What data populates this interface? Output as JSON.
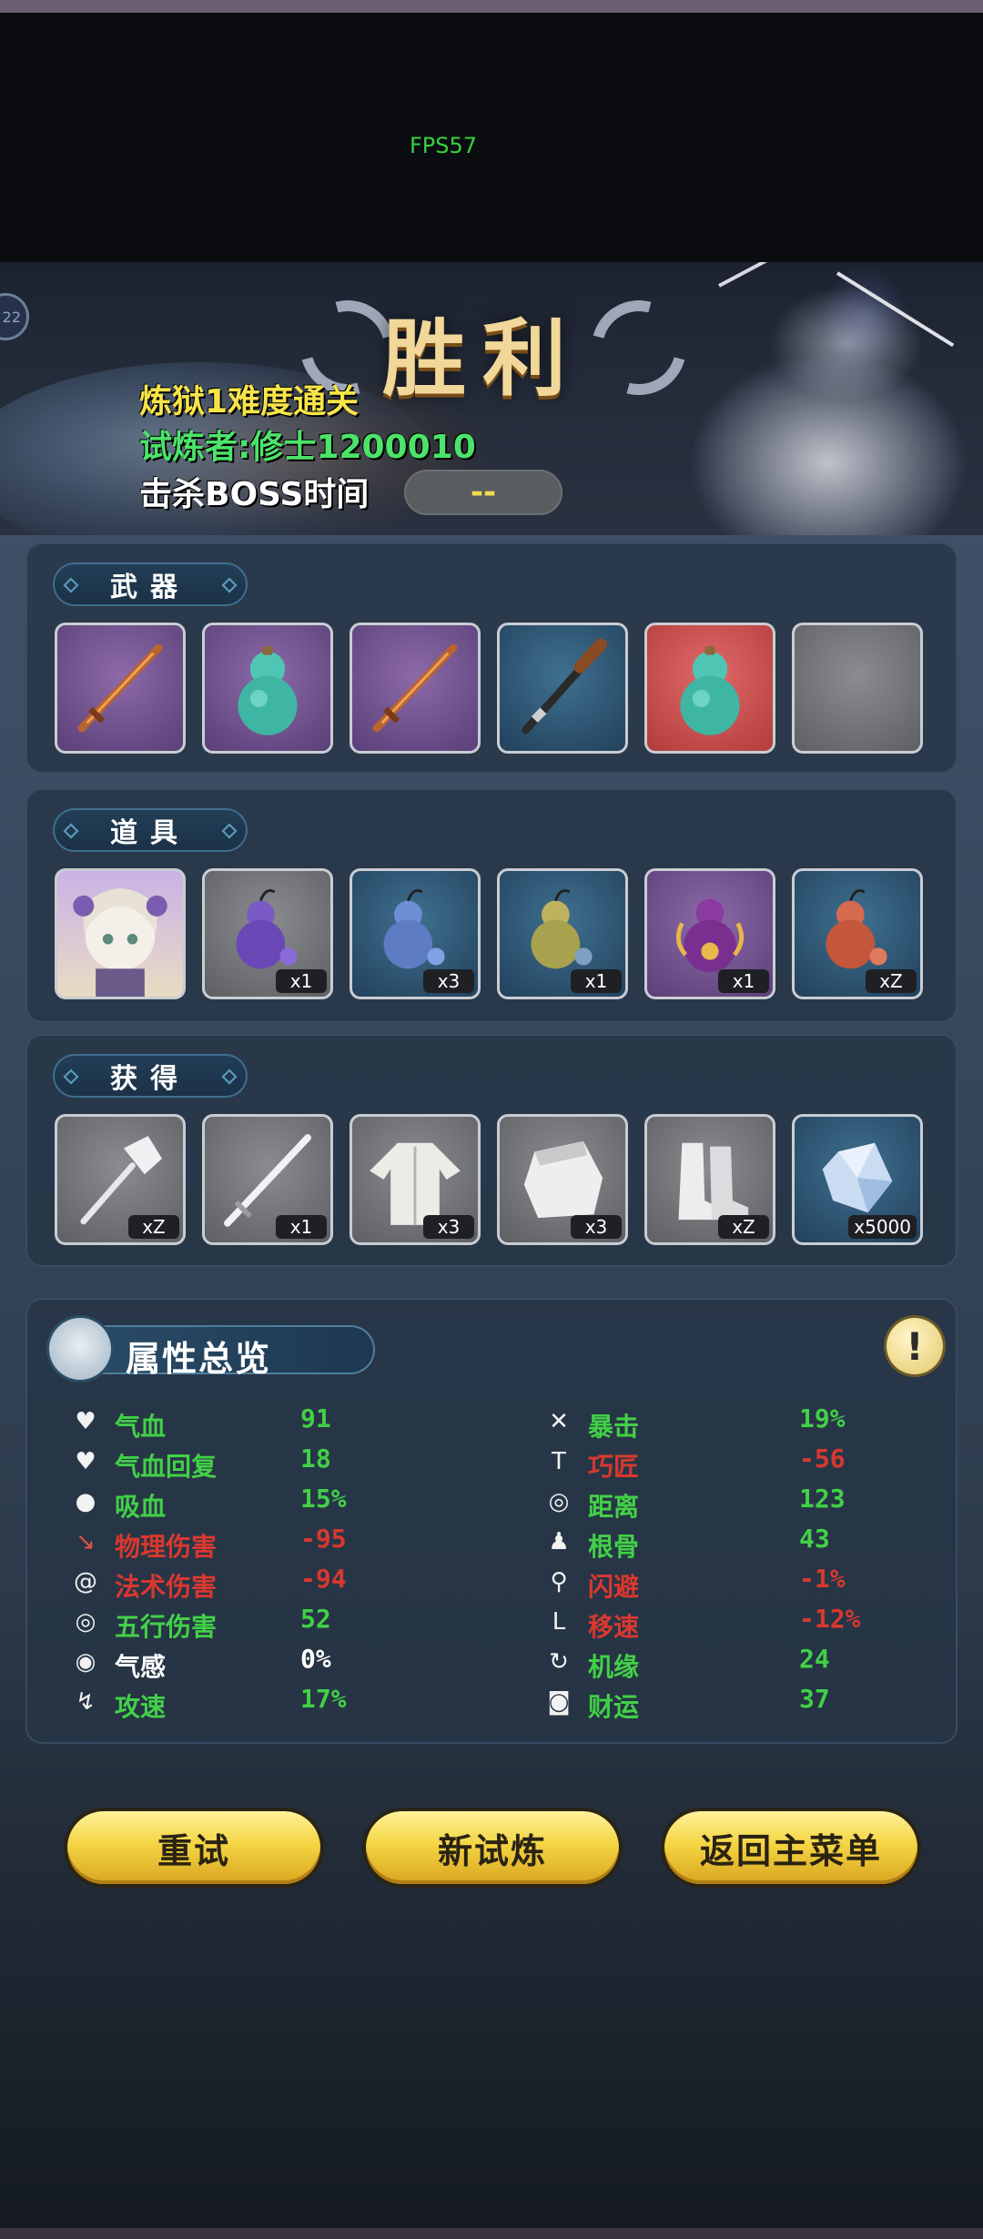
{
  "fps": "FPS57",
  "banner": {
    "title": "胜利",
    "level": "22",
    "difficulty": "炼狱1难度通关",
    "trainee": "试炼者:修士1200010",
    "boss_time_label": "击杀BOSS时间",
    "boss_time_value": "--"
  },
  "weapons": {
    "label": "武器",
    "slots": [
      {
        "icon": "bronze-sword-icon",
        "rarity": "purple"
      },
      {
        "icon": "jade-gourd-icon",
        "rarity": "purple"
      },
      {
        "icon": "bronze-sword-icon",
        "rarity": "purple"
      },
      {
        "icon": "staff-icon",
        "rarity": "blue"
      },
      {
        "icon": "jade-gourd-icon",
        "rarity": "red"
      },
      {
        "icon": "empty-slot",
        "rarity": "gray"
      }
    ]
  },
  "items": {
    "label": "道具",
    "slots": [
      {
        "icon": "character-portrait",
        "qty": ""
      },
      {
        "icon": "purple-gourd-potion-icon",
        "qty": "x1"
      },
      {
        "icon": "blue-gourd-potion-icon",
        "qty": "x3"
      },
      {
        "icon": "yellow-gourd-potion-icon",
        "qty": "x1"
      },
      {
        "icon": "ornate-gourd-potion-icon",
        "qty": "x1"
      },
      {
        "icon": "red-gourd-potion-icon",
        "qty": "xZ"
      }
    ]
  },
  "rewards": {
    "label": "获得",
    "slots": [
      {
        "icon": "hammer-icon",
        "qty": "xZ"
      },
      {
        "icon": "sword-icon",
        "qty": "x1"
      },
      {
        "icon": "robe-icon",
        "qty": "x3"
      },
      {
        "icon": "bracer-icon",
        "qty": "x3"
      },
      {
        "icon": "boots-icon",
        "qty": "xZ"
      },
      {
        "icon": "crystal-icon",
        "qty": "x5000"
      }
    ]
  },
  "stats": {
    "title": "属性总览",
    "left": [
      {
        "label": "气血",
        "value": "91",
        "value_color": "green",
        "label_color": "green",
        "icon": "heart-icon"
      },
      {
        "label": "气血回复",
        "value": "18",
        "value_color": "green",
        "label_color": "green",
        "icon": "heart-regen-icon"
      },
      {
        "label": "吸血",
        "value": "15%",
        "value_color": "green",
        "label_color": "green",
        "icon": "blood-drop-icon"
      },
      {
        "label": "物理伤害",
        "value": "-95",
        "value_color": "red",
        "label_color": "red",
        "icon": "dagger-icon"
      },
      {
        "label": "法术伤害",
        "value": "-94",
        "value_color": "red",
        "label_color": "red",
        "icon": "spiral-icon"
      },
      {
        "label": "五行伤害",
        "value": "52",
        "value_color": "green",
        "label_color": "green",
        "icon": "elements-icon"
      },
      {
        "label": "气感",
        "value": "0%",
        "value_color": "white",
        "label_color": "white",
        "icon": "qi-sense-icon"
      },
      {
        "label": "攻速",
        "value": "17%",
        "value_color": "green",
        "label_color": "green",
        "icon": "attack-speed-icon"
      }
    ],
    "right": [
      {
        "label": "暴击",
        "value": "19%",
        "value_color": "green",
        "label_color": "green",
        "icon": "crit-icon"
      },
      {
        "label": "巧匠",
        "value": "-56",
        "value_color": "red",
        "label_color": "red",
        "icon": "hammer-tool-icon"
      },
      {
        "label": "距离",
        "value": "123",
        "value_color": "green",
        "label_color": "green",
        "icon": "range-icon"
      },
      {
        "label": "根骨",
        "value": "43",
        "value_color": "green",
        "label_color": "green",
        "icon": "body-icon"
      },
      {
        "label": "闪避",
        "value": "-1%",
        "value_color": "red",
        "label_color": "red",
        "icon": "dodge-icon"
      },
      {
        "label": "移速",
        "value": "-12%",
        "value_color": "red",
        "label_color": "red",
        "icon": "boot-speed-icon"
      },
      {
        "label": "机缘",
        "value": "24",
        "value_color": "green",
        "label_color": "green",
        "icon": "fortune-swirl-icon"
      },
      {
        "label": "财运",
        "value": "37",
        "value_color": "green",
        "label_color": "green",
        "icon": "coin-icon"
      }
    ]
  },
  "buttons": {
    "retry": "重试",
    "new_trial": "新试炼",
    "main_menu": "返回主菜单"
  }
}
